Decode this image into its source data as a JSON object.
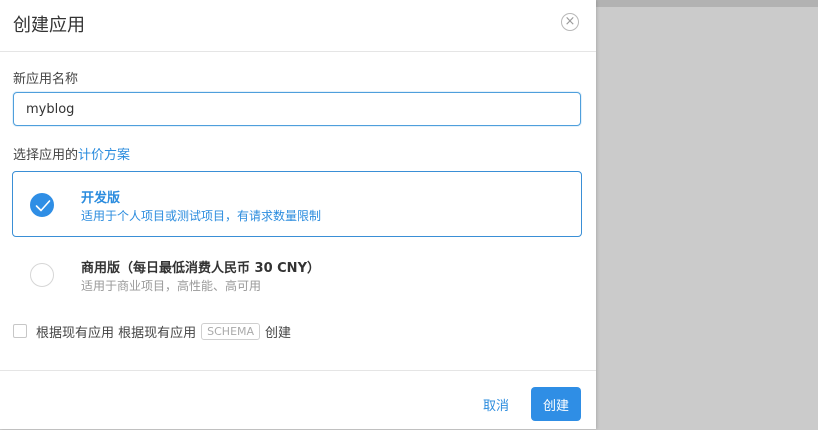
{
  "dialog": {
    "title": "创建应用",
    "close_glyph": "×"
  },
  "form": {
    "name_label": "新应用名称",
    "name_value": "myblog",
    "plan_label_prefix": "选择应用的",
    "plan_label_link": "计价方案"
  },
  "plans": [
    {
      "name": "开发版",
      "desc": "适用于个人项目或测试项目，有请求数量限制",
      "selected": true
    },
    {
      "name": "商用版（每日最低消费人民币 30 CNY）",
      "desc": "适用于商业项目，高性能、高可用",
      "selected": false
    }
  ],
  "schema_option": {
    "text_before": "根据现有应用 根据现有应用",
    "badge": "SCHEMA",
    "text_after": "创建",
    "checked": false
  },
  "footer": {
    "cancel_label": "取消",
    "create_label": "创建"
  },
  "colors": {
    "accent": "#2f8ee5",
    "link": "#2b8cde",
    "overlay": "#cbcbcb"
  },
  "icons": {
    "close": "close-icon",
    "check": "checkmark-icon"
  }
}
